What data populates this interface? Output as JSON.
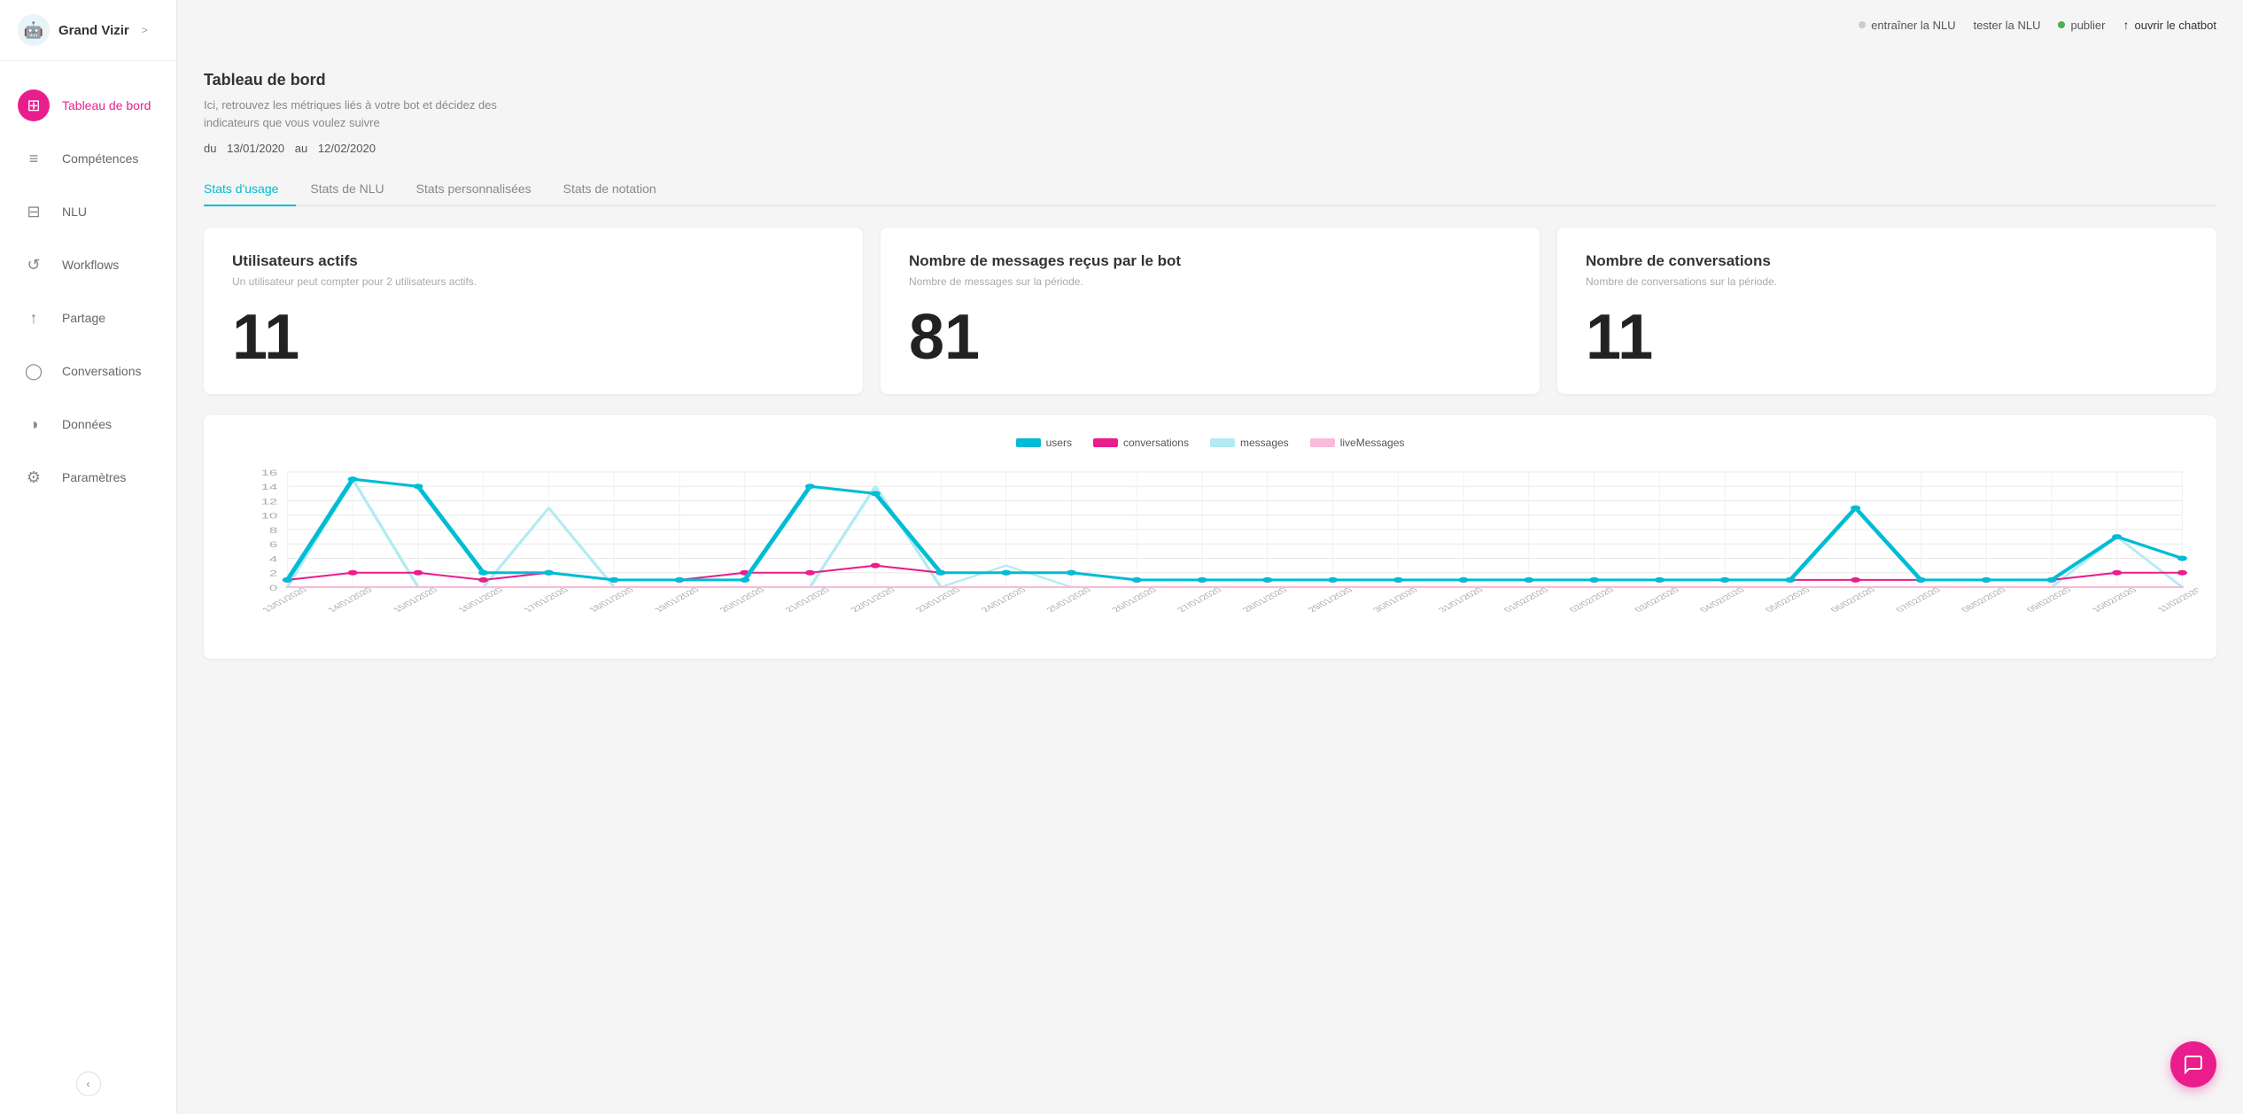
{
  "sidebar": {
    "logo": "🤖",
    "title": "Grand Vizir",
    "chevron": ">",
    "items": [
      {
        "id": "tableau",
        "label": "Tableau de bord",
        "icon": "⊞",
        "active": true
      },
      {
        "id": "competences",
        "label": "Compétences",
        "icon": "≡",
        "active": false
      },
      {
        "id": "nlu",
        "label": "NLU",
        "icon": "⊟",
        "active": false
      },
      {
        "id": "workflows",
        "label": "Workflows",
        "icon": "↺",
        "active": false
      },
      {
        "id": "partage",
        "label": "Partage",
        "icon": "↑",
        "active": false
      },
      {
        "id": "conversations",
        "label": "Conversations",
        "icon": "◯",
        "active": false
      },
      {
        "id": "donnees",
        "label": "Données",
        "icon": "◑",
        "active": false
      },
      {
        "id": "parametres",
        "label": "Paramètres",
        "icon": "⚙",
        "active": false
      }
    ],
    "collapse_label": "‹"
  },
  "topbar": {
    "train_nlu": "entraîner la NLU",
    "test_nlu": "tester la NLU",
    "publish": "publier",
    "open_chatbot": "ouvrir le chatbot"
  },
  "page": {
    "title": "Tableau de bord",
    "description": "Ici, retrouvez les métriques liés à votre bot et décidez des indicateurs que vous voulez suivre",
    "date_from_label": "du",
    "date_from": "13/01/2020",
    "date_to_label": "au",
    "date_to": "12/02/2020"
  },
  "tabs": [
    {
      "id": "usage",
      "label": "Stats d'usage",
      "active": true
    },
    {
      "id": "nlu",
      "label": "Stats de NLU",
      "active": false
    },
    {
      "id": "custom",
      "label": "Stats personnalisées",
      "active": false
    },
    {
      "id": "notation",
      "label": "Stats de notation",
      "active": false
    }
  ],
  "stats_cards": [
    {
      "id": "active_users",
      "title": "Utilisateurs actifs",
      "description": "Un utilisateur peut compter pour 2 utilisateurs actifs.",
      "value": "11"
    },
    {
      "id": "messages_received",
      "title": "Nombre de messages reçus par le bot",
      "description": "Nombre de messages sur la période.",
      "value": "81"
    },
    {
      "id": "conversations",
      "title": "Nombre de conversations",
      "description": "Nombre de conversations sur la période.",
      "value": "11"
    }
  ],
  "chart": {
    "legend": [
      {
        "id": "users",
        "label": "users",
        "color": "#00bcd4",
        "stroke_width": 3
      },
      {
        "id": "conversations",
        "label": "conversations",
        "color": "#e91e8c",
        "stroke_width": 2
      },
      {
        "id": "messages",
        "label": "messages",
        "color": "#b2ebf2",
        "stroke_width": 2
      },
      {
        "id": "liveMessages",
        "label": "liveMessages",
        "color": "#f8bbd9",
        "stroke_width": 2
      }
    ],
    "x_labels": [
      "13/01/2020",
      "14/01/2020",
      "15/01/2020",
      "16/01/2020",
      "17/01/2020",
      "18/01/2020",
      "19/01/2020",
      "20/01/2020",
      "21/01/2020",
      "22/01/2020",
      "23/01/2020",
      "24/01/2020",
      "25/01/2020",
      "26/01/2020",
      "27/01/2020",
      "28/01/2020",
      "29/01/2020",
      "30/01/2020",
      "31/01/2020",
      "01/02/2020",
      "02/02/2020",
      "03/02/2020",
      "04/02/2020",
      "05/02/2020",
      "06/02/2020",
      "07/02/2020",
      "08/02/2020",
      "09/02/2020",
      "10/02/2020",
      "11/02/2020"
    ],
    "y_labels": [
      "0",
      "2",
      "4",
      "6",
      "8",
      "10",
      "12",
      "14",
      "16"
    ],
    "y_max": 16,
    "users_data": [
      1,
      15,
      14,
      2,
      2,
      1,
      1,
      1,
      14,
      13,
      2,
      2,
      2,
      1,
      1,
      1,
      1,
      1,
      1,
      1,
      1,
      1,
      1,
      1,
      11,
      1,
      1,
      1,
      7,
      4
    ],
    "conversations_data": [
      1,
      2,
      2,
      1,
      2,
      1,
      1,
      2,
      2,
      3,
      2,
      2,
      2,
      1,
      1,
      1,
      1,
      1,
      1,
      1,
      1,
      1,
      1,
      1,
      1,
      1,
      1,
      1,
      2,
      2
    ],
    "messages_data": [
      0,
      15,
      0,
      0,
      11,
      0,
      0,
      0,
      0,
      14,
      0,
      3,
      0,
      0,
      0,
      0,
      0,
      0,
      0,
      0,
      0,
      0,
      0,
      0,
      0,
      0,
      0,
      0,
      7,
      0
    ],
    "liveMessages_data": [
      0,
      0,
      0,
      0,
      0,
      0,
      0,
      0,
      0,
      0,
      0,
      0,
      0,
      0,
      0,
      0,
      0,
      0,
      0,
      0,
      0,
      0,
      0,
      0,
      0,
      0,
      0,
      0,
      0,
      0
    ]
  }
}
